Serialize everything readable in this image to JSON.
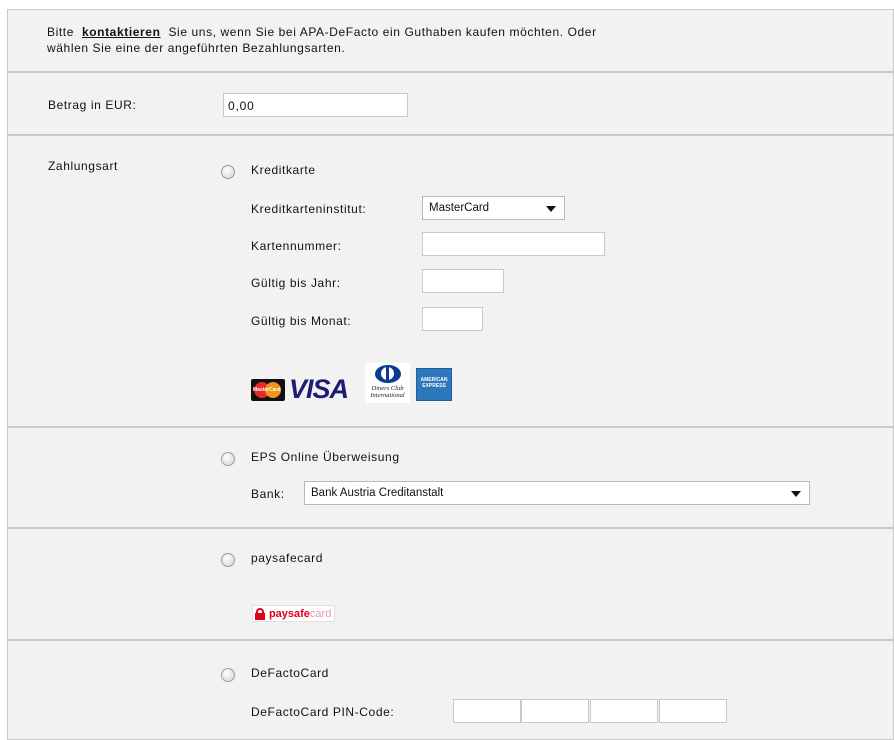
{
  "intro": {
    "before_link": "Bitte",
    "link_label": "kontaktieren",
    "after_link": "Sie uns, wenn Sie bei APA-DeFacto ein Guthaben kaufen möchten. Oder",
    "line2": "wählen Sie eine der angeführten Bezahlungsarten."
  },
  "amount": {
    "label": "Betrag in EUR:",
    "value": "0,00"
  },
  "payment": {
    "label": "Zahlungsart",
    "credit_card": {
      "radio_label": "Kreditkarte",
      "institute_label": "Kreditkarteninstitut:",
      "institute_value": "MasterCard",
      "number_label": "Kartennummer:",
      "year_label": "Gültig bis Jahr:",
      "month_label": "Gültig bis Monat:",
      "logos": {
        "mastercard": "MasterCard",
        "visa": "VISA",
        "diners": "Diners Club International",
        "amex": "AMERICAN EXPRESS"
      }
    },
    "eps": {
      "radio_label": "EPS Online Überweisung",
      "bank_label": "Bank:",
      "bank_value": "Bank Austria Creditanstalt"
    },
    "paysafecard": {
      "radio_label": "paysafecard",
      "logo_text_bold": "paysafe",
      "logo_text_light": "card"
    },
    "defactocard": {
      "radio_label": "DeFactoCard",
      "pin_label": "DeFactoCard PIN-Code:"
    }
  },
  "colors": {
    "panel_bg": "#f2f2f2",
    "panel_border": "#c9c9c9",
    "visa_blue": "#1a1f71",
    "amex_blue": "#2e77bb",
    "mastercard_red": "#e8282b",
    "mastercard_orange": "#f79e1b",
    "paysafe_red": "#e3001b"
  }
}
